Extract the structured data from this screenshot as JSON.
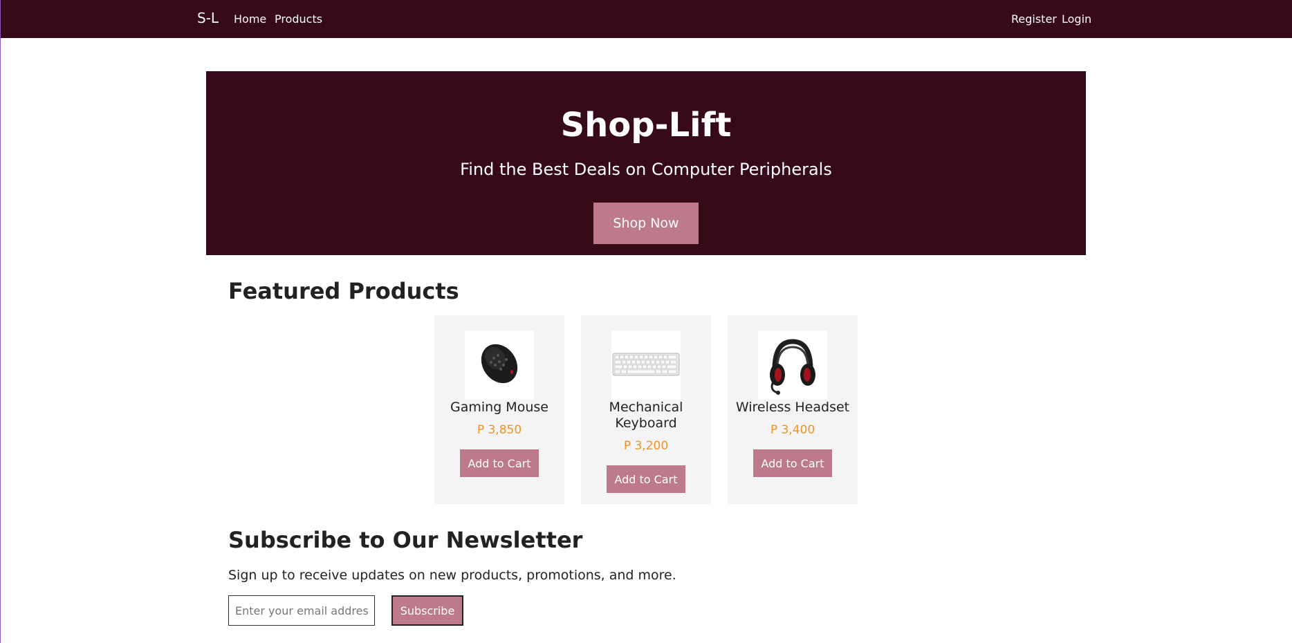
{
  "navbar": {
    "brand": "S-L",
    "links": [
      "Home",
      "Products"
    ],
    "right_links": [
      "Register",
      "Login"
    ]
  },
  "hero": {
    "title": "Shop-Lift",
    "subtitle": "Find the Best Deals on Computer Peripherals",
    "button": "Shop Now"
  },
  "featured": {
    "title": "Featured Products",
    "products": [
      {
        "name": "Gaming Mouse",
        "price": "P 3,850",
        "button": "Add to Cart",
        "icon": "mouse-icon"
      },
      {
        "name": "Mechanical Keyboard",
        "price": "P 3,200",
        "button": "Add to Cart",
        "icon": "keyboard-icon"
      },
      {
        "name": "Wireless Headset",
        "price": "P 3,400",
        "button": "Add to Cart",
        "icon": "headset-icon"
      }
    ]
  },
  "newsletter": {
    "title": "Subscribe to Our Newsletter",
    "description": "Sign up to receive updates on new products, promotions, and more.",
    "placeholder": "Enter your email address",
    "button": "Subscribe"
  },
  "colors": {
    "brand_dark": "#360a16",
    "accent": "#bd7a8a",
    "price": "#f29224",
    "card_bg": "#f4f4f4"
  }
}
